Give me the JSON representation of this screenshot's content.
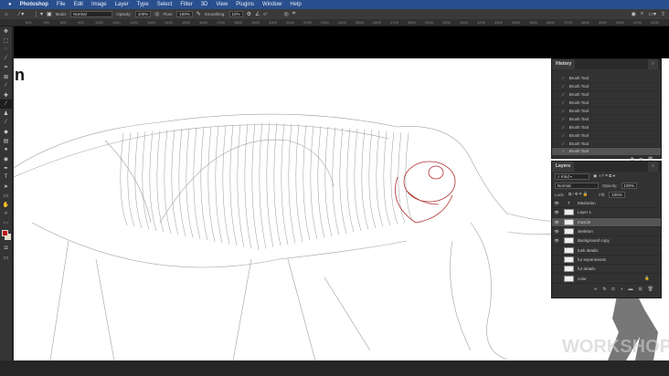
{
  "menubar": {
    "apple": "",
    "app": "Photoshop",
    "items": [
      "File",
      "Edit",
      "Image",
      "Layer",
      "Type",
      "Select",
      "Filter",
      "3D",
      "View",
      "Plugins",
      "Window",
      "Help"
    ]
  },
  "options": {
    "mode_label": "Mode:",
    "mode": "Normal",
    "opacity_label": "Opacity:",
    "opacity": "100%",
    "flow_label": "Flow:",
    "flow": "100%",
    "smoothing_label": "Smoothing:",
    "smoothing": "10%",
    "angle": "0°"
  },
  "ruler": [
    "600",
    "700",
    "800",
    "900",
    "1000",
    "1100",
    "1200",
    "1300",
    "1400",
    "1500",
    "1600",
    "1700",
    "1800",
    "1900",
    "2000",
    "2100",
    "2200",
    "2300",
    "2400",
    "2500",
    "2600",
    "2700",
    "2800",
    "2900",
    "3000",
    "3100",
    "3200",
    "3300",
    "3400",
    "3500",
    "3600",
    "3700",
    "3800",
    "3900",
    "4000",
    "4100",
    "4200"
  ],
  "canvas": {
    "title_fragment": "n",
    "watermark": "WORKSHOP"
  },
  "history": {
    "title": "History",
    "items": [
      "Brush Tool",
      "Brush Tool",
      "Brush Tool",
      "Brush Tool",
      "Brush Tool",
      "Brush Tool",
      "Brush Tool",
      "Brush Tool",
      "Brush Tool",
      "Brush Tool"
    ],
    "selected": 9
  },
  "layers": {
    "title": "Layers",
    "kind": "Kind",
    "blend": "Normal",
    "opacity_label": "Opacity:",
    "opacity": "100%",
    "lock_label": "Lock:",
    "fill_label": "Fill:",
    "fill": "100%",
    "items": [
      {
        "name": "Mastodon",
        "visible": true,
        "type": "text"
      },
      {
        "name": "Layer 1",
        "visible": true
      },
      {
        "name": "muscle",
        "visible": true,
        "selected": true
      },
      {
        "name": "skeleton",
        "visible": true
      },
      {
        "name": "Background copy",
        "visible": true
      },
      {
        "name": "tusk details",
        "visible": false
      },
      {
        "name": "fur experiments",
        "visible": false
      },
      {
        "name": "fur details",
        "visible": false
      },
      {
        "name": "color",
        "visible": false,
        "locked": true
      }
    ]
  },
  "colors": {
    "foreground": "#c0141a",
    "background": "#e8dcc0",
    "menubar": "#2a4f8e"
  }
}
